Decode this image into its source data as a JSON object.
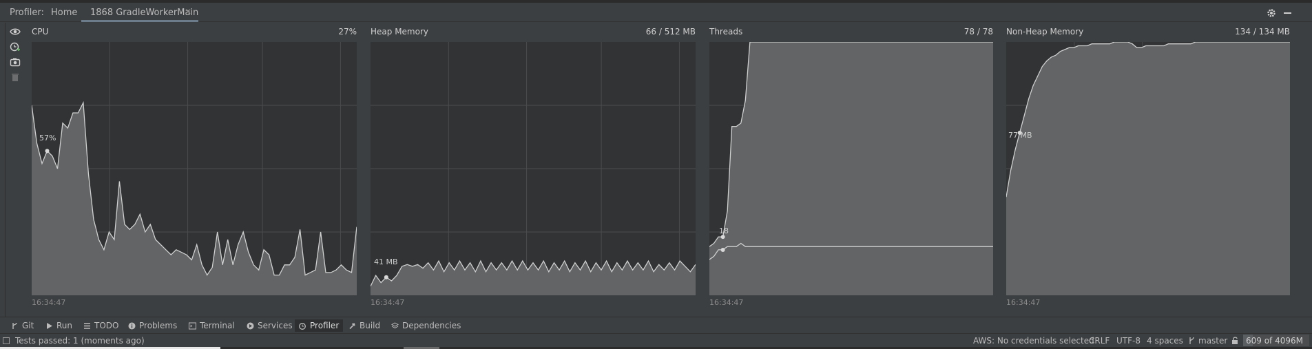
{
  "header": {
    "profiler_label": "Profiler:",
    "tabs": [
      {
        "label": "Home"
      },
      {
        "label": "1868 GradleWorkerMain",
        "active": true,
        "close": "✕"
      }
    ]
  },
  "panels": {
    "cpu": {
      "title": "CPU",
      "value": "27%",
      "peak_label": "57%",
      "time": "16:34:47"
    },
    "heap": {
      "title": "Heap Memory",
      "value": "66 / 512 MB",
      "point_label": "41 MB",
      "time": "16:34:47"
    },
    "threads": {
      "title": "Threads",
      "value": "78 / 78",
      "point_label": "18",
      "time": "16:34:47"
    },
    "nonheap": {
      "title": "Non-Heap Memory",
      "value": "134 / 134 MB",
      "point_label": "77 MB",
      "time": "16:34:47"
    }
  },
  "chart_data": [
    {
      "type": "area",
      "title": "CPU",
      "unit": "%",
      "ylim": [
        0,
        100
      ],
      "values": [
        75,
        60,
        52,
        57,
        55,
        50,
        68,
        66,
        72,
        72,
        76,
        48,
        30,
        22,
        18,
        25,
        22,
        45,
        28,
        26,
        28,
        32,
        25,
        28,
        22,
        20,
        18,
        16,
        18,
        17,
        16,
        14,
        20,
        12,
        8,
        11,
        25,
        12,
        22,
        12,
        20,
        25,
        17,
        12,
        10,
        18,
        16,
        8,
        8,
        12,
        12,
        15,
        26,
        8,
        9,
        10,
        25,
        9,
        9,
        10,
        12,
        10,
        9,
        27
      ],
      "grid": true
    },
    {
      "type": "area",
      "title": "Heap Memory",
      "unit": "MB",
      "ylim": [
        0,
        140
      ],
      "values": [
        5,
        11,
        7,
        10,
        8,
        11,
        16,
        17,
        16,
        17,
        15,
        18,
        14,
        19,
        13,
        18,
        14,
        19,
        14,
        18,
        13,
        19,
        13,
        18,
        14,
        18,
        14,
        19,
        14,
        19,
        14,
        18,
        14,
        19,
        13,
        18,
        14,
        19,
        13,
        18,
        14,
        19,
        13,
        18,
        14,
        19,
        13,
        18,
        14,
        19,
        14,
        18,
        14,
        19,
        13,
        17,
        14,
        18,
        14,
        19,
        16,
        13,
        17
      ],
      "grid": true
    },
    {
      "type": "area",
      "title": "Threads",
      "ylim": [
        0,
        78
      ],
      "series": [
        {
          "values": [
            15,
            16,
            18,
            18,
            26,
            52,
            52,
            53,
            60,
            78,
            78,
            78,
            78,
            78,
            78,
            78,
            78,
            78,
            78,
            78,
            78,
            78,
            78,
            78,
            78,
            78,
            78,
            78,
            78,
            78,
            78,
            78,
            78,
            78,
            78,
            78,
            78,
            78,
            78,
            78,
            78,
            78,
            78,
            78,
            78,
            78,
            78,
            78,
            78,
            78,
            78,
            78,
            78,
            78,
            78,
            78,
            78,
            78,
            78,
            78,
            78,
            78,
            78,
            78
          ]
        },
        {
          "values": [
            11,
            12,
            14,
            14,
            15,
            15,
            15,
            16,
            15,
            15,
            15,
            15,
            15,
            15,
            15,
            15,
            15,
            15,
            15,
            15,
            15,
            15,
            15,
            15,
            15,
            15,
            15,
            15,
            15,
            15,
            15,
            15,
            15,
            15,
            15,
            15,
            15,
            15,
            15,
            15,
            15,
            15,
            15,
            15,
            15,
            15,
            15,
            15,
            15,
            15,
            15,
            15,
            15,
            15,
            15,
            15,
            15,
            15,
            15,
            15,
            15,
            15,
            15,
            15
          ]
        }
      ],
      "grid": true
    },
    {
      "type": "area",
      "title": "Non-Heap Memory",
      "unit": "MB",
      "ylim": [
        0,
        134
      ],
      "values": [
        52,
        66,
        77,
        86,
        95,
        104,
        111,
        116,
        121,
        124,
        126,
        127,
        129,
        130,
        131,
        131,
        132,
        132,
        132,
        133,
        133,
        133,
        133,
        133,
        134,
        134,
        134,
        134,
        133,
        131,
        131,
        132,
        132,
        132,
        132,
        132,
        133,
        133,
        133,
        133,
        133,
        133,
        134,
        134,
        134,
        134,
        134,
        134,
        134,
        134,
        134,
        134,
        134,
        134,
        134,
        134,
        134,
        134,
        134,
        134,
        134,
        134,
        134,
        134
      ],
      "grid": true
    }
  ],
  "bottom_tabs": [
    {
      "label": "Git",
      "icon": "branch-icon"
    },
    {
      "label": "Run",
      "icon": "play-icon"
    },
    {
      "label": "TODO",
      "icon": "list-icon"
    },
    {
      "label": "Problems",
      "icon": "info-icon"
    },
    {
      "label": "Terminal",
      "icon": "terminal-icon"
    },
    {
      "label": "Services",
      "icon": "services-icon"
    },
    {
      "label": "Profiler",
      "icon": "profiler-icon",
      "active": true
    },
    {
      "label": "Build",
      "icon": "hammer-icon"
    },
    {
      "label": "Dependencies",
      "icon": "layers-icon"
    }
  ],
  "status": {
    "message": "Tests passed: 1 (moments ago)",
    "aws": "AWS: No credentials selected",
    "line_ending": "CRLF",
    "encoding": "UTF-8",
    "indent": "4 spaces",
    "branch": "master",
    "memory": "609 of 4096M",
    "memory_fraction": 0.149
  },
  "colors": {
    "background": "#3c3f41",
    "chart_background": "#313335",
    "chart_fill": "#626466",
    "chart_line": "#d0d0d0",
    "grid": "#4a4c4e"
  }
}
